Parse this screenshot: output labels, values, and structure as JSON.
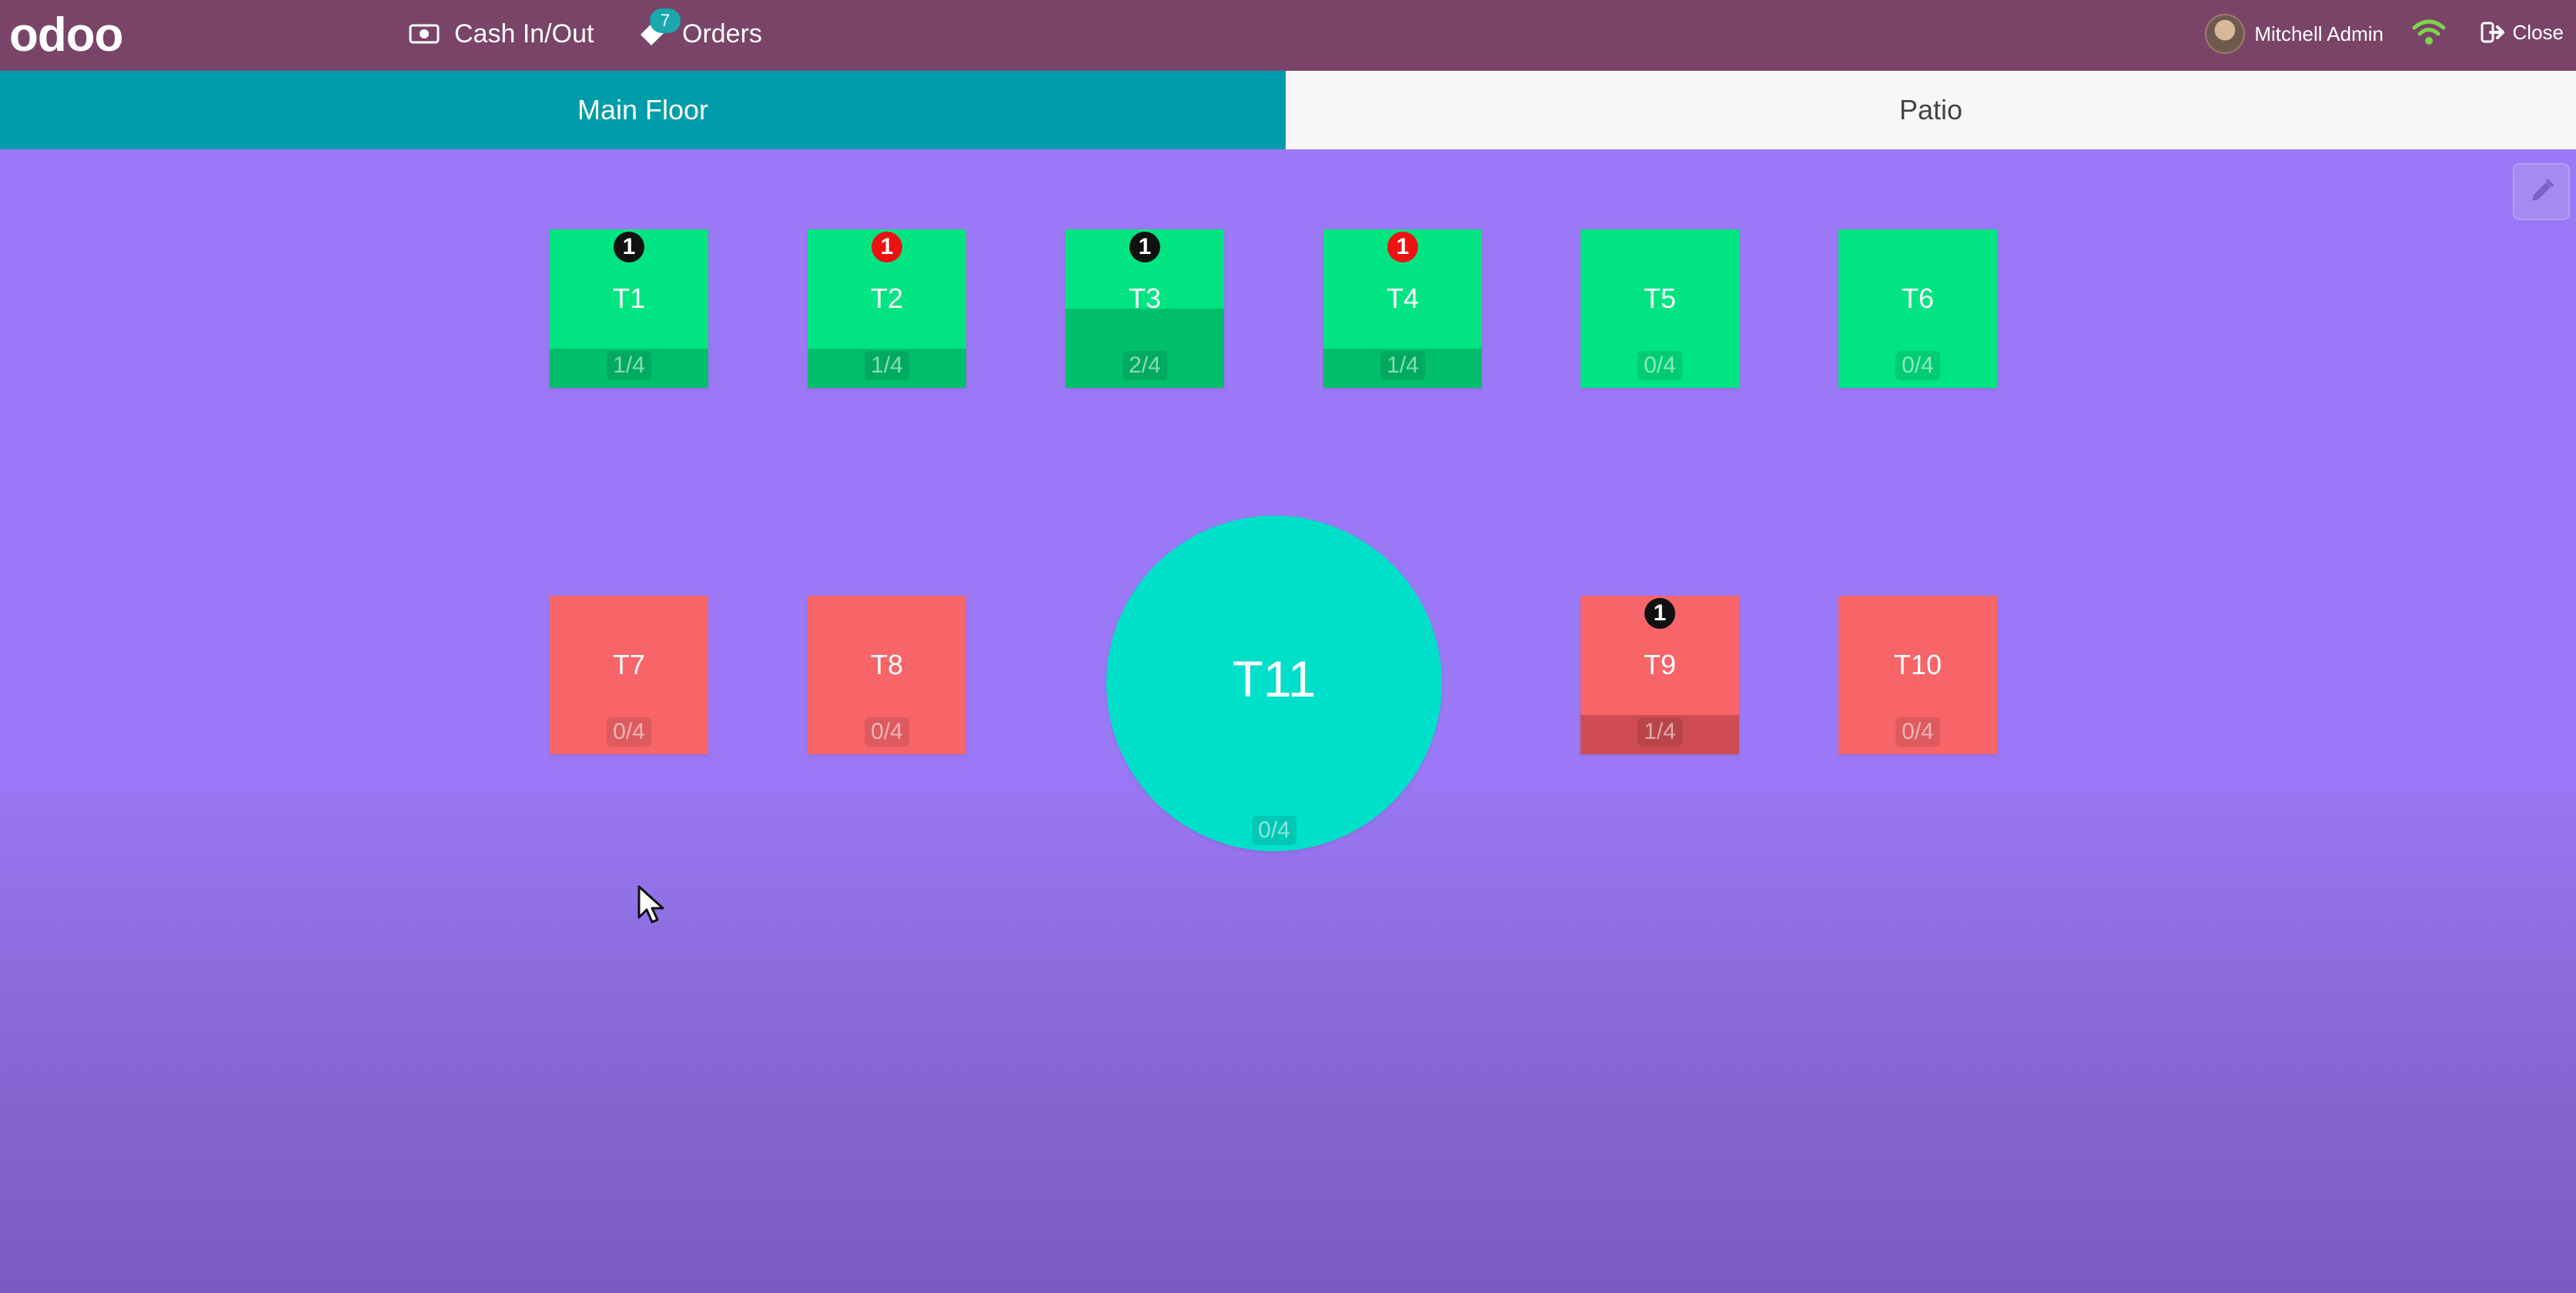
{
  "header": {
    "logo": "odoo",
    "cash_label": "Cash In/Out",
    "orders_label": "Orders",
    "orders_count": "7",
    "user_name": "Mitchell Admin",
    "close_label": "Close",
    "colors": {
      "bar": "#7a4469",
      "badge": "#1aa8ad",
      "wifi": "#7ed44a"
    }
  },
  "floors": [
    {
      "label": "Main Floor",
      "active": true
    },
    {
      "label": "Patio",
      "active": false
    }
  ],
  "tables": [
    {
      "name": "T1",
      "seats": "1/4",
      "orders": "1",
      "badge": "black",
      "color": "green",
      "occupancy": 0.25
    },
    {
      "name": "T2",
      "seats": "1/4",
      "orders": "1",
      "badge": "red",
      "color": "green",
      "occupancy": 0.25
    },
    {
      "name": "T3",
      "seats": "2/4",
      "orders": "1",
      "badge": "black",
      "color": "green",
      "occupancy": 0.5
    },
    {
      "name": "T4",
      "seats": "1/4",
      "orders": "1",
      "badge": "red",
      "color": "green",
      "occupancy": 0.25
    },
    {
      "name": "T5",
      "seats": "0/4",
      "orders": "",
      "badge": "",
      "color": "green",
      "occupancy": 0
    },
    {
      "name": "T6",
      "seats": "0/4",
      "orders": "",
      "badge": "",
      "color": "green",
      "occupancy": 0
    },
    {
      "name": "T7",
      "seats": "0/4",
      "orders": "",
      "badge": "",
      "color": "red",
      "occupancy": 0
    },
    {
      "name": "T8",
      "seats": "0/4",
      "orders": "",
      "badge": "",
      "color": "red",
      "occupancy": 0
    },
    {
      "name": "T11",
      "seats": "0/4",
      "orders": "",
      "badge": "",
      "color": "turquoise",
      "shape": "round",
      "occupancy": 0
    },
    {
      "name": "T9",
      "seats": "1/4",
      "orders": "1",
      "badge": "black",
      "color": "red",
      "occupancy": 0.25
    },
    {
      "name": "T10",
      "seats": "0/4",
      "orders": "",
      "badge": "",
      "color": "red",
      "occupancy": 0
    }
  ],
  "floor_colors": {
    "background": "#9b78f6",
    "green_table": "#00e581",
    "red_table": "#f76569",
    "round_table": "#00dfca"
  },
  "icons": [
    "cash-icon",
    "orders-tag-icon",
    "avatar",
    "wifi-icon",
    "sign-out-icon",
    "pencil-icon",
    "mouse-cursor-icon"
  ]
}
